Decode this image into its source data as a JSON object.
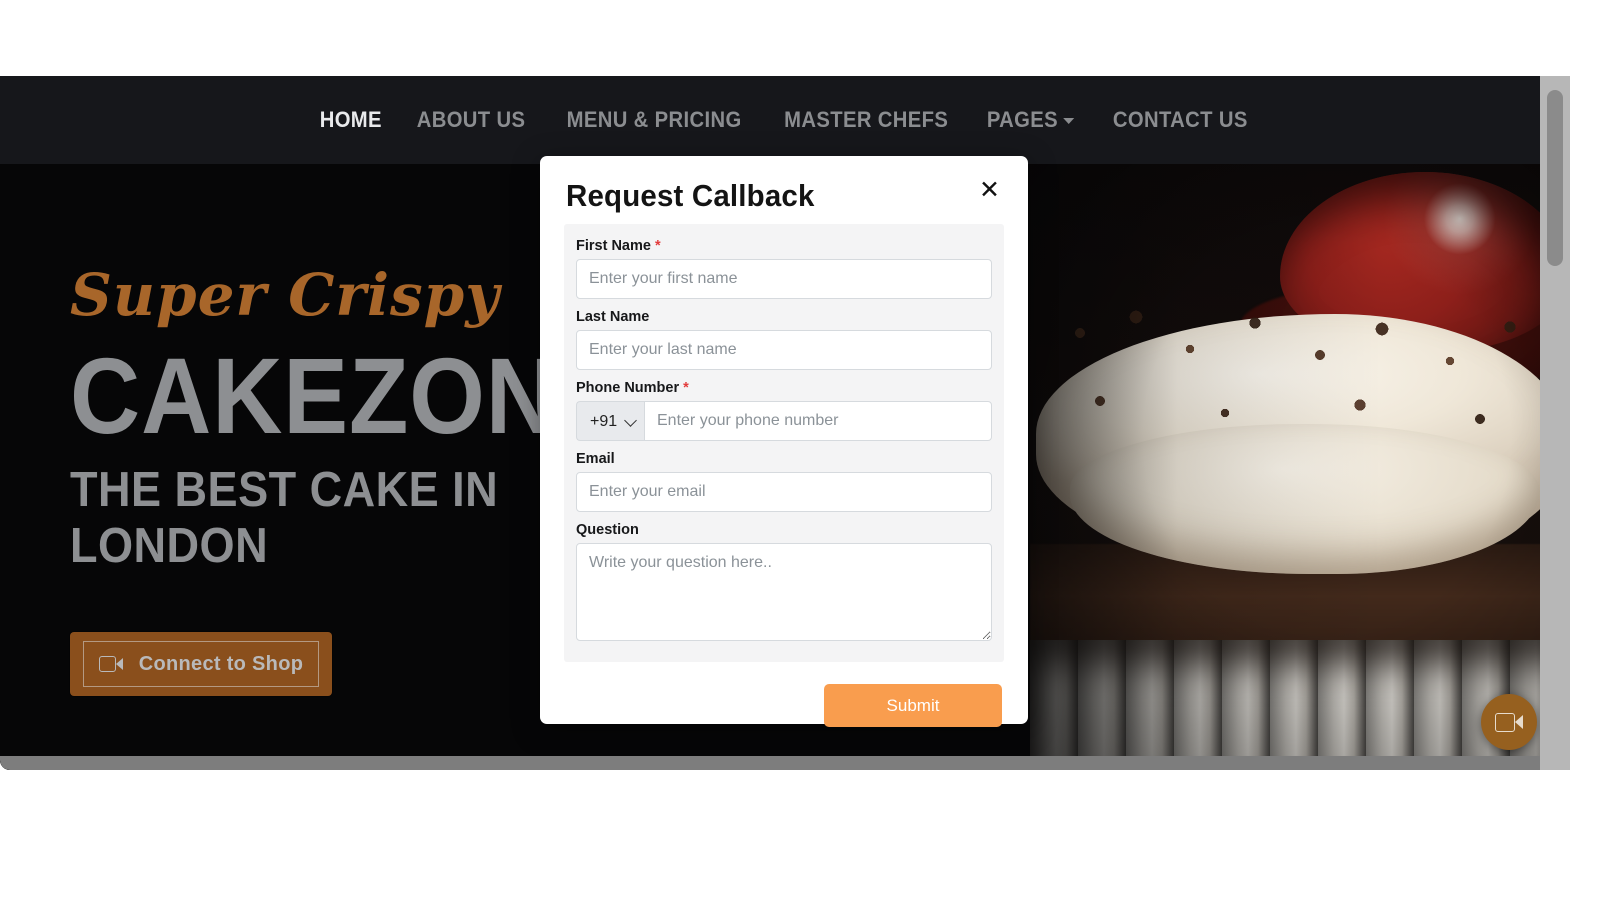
{
  "navbar": {
    "items": [
      {
        "label": "HOME",
        "active": true,
        "caret": false
      },
      {
        "label": "ABOUT US",
        "active": false,
        "caret": false
      },
      {
        "label": "MENU & PRICING",
        "active": false,
        "caret": false
      },
      {
        "label": "MASTER CHEFS",
        "active": false,
        "caret": false
      },
      {
        "label": "PAGES",
        "active": false,
        "caret": true
      },
      {
        "label": "CONTACT US",
        "active": false,
        "caret": false
      }
    ]
  },
  "hero": {
    "script_text": "Super Crispy",
    "title": "CAKEZONE",
    "subtitle": "THE BEST CAKE IN LONDON",
    "cta_label": "Connect to Shop",
    "cta_icon": "video-camera-icon",
    "script_color": "#a8662a",
    "title_color": "#8d8f92",
    "cta_bg": "#8a4f1c"
  },
  "fab": {
    "icon": "video-camera-icon",
    "color": "#96601f"
  },
  "modal": {
    "title": "Request Callback",
    "close_icon": "close-icon",
    "fields": {
      "first_name": {
        "label": "First Name",
        "required": true,
        "placeholder": "Enter your first name",
        "value": ""
      },
      "last_name": {
        "label": "Last Name",
        "required": false,
        "placeholder": "Enter your last name",
        "value": ""
      },
      "phone": {
        "label": "Phone Number",
        "required": true,
        "country_code": "+91",
        "country_code_options": [
          "+91"
        ],
        "placeholder": "Enter your phone number",
        "value": ""
      },
      "email": {
        "label": "Email",
        "required": false,
        "placeholder": "Enter your email",
        "value": ""
      },
      "question": {
        "label": "Question",
        "required": false,
        "placeholder": "Write your question here..",
        "value": ""
      }
    },
    "submit_label": "Submit",
    "submit_color": "#f99d4e",
    "required_marker": "*"
  }
}
